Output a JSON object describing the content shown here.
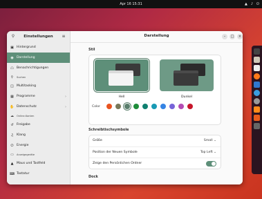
{
  "topbar": {
    "clock": "Apr 16 15:31",
    "status_icons": [
      "network-icon",
      "speaker-icon",
      "power-icon"
    ]
  },
  "sidebar": {
    "title": "Einstellungen",
    "search_icon": "search-icon",
    "menu_icon": "menu-icon",
    "items": [
      {
        "label": "Hintergrund",
        "icon": "image-icon",
        "size": "normal"
      },
      {
        "label": "Darstellung",
        "icon": "palette-icon",
        "size": "normal",
        "active": true
      },
      {
        "label": "Benachrichtigungen",
        "icon": "bell-icon",
        "size": "normal"
      },
      {
        "label": "Suchen",
        "icon": "search-icon",
        "size": "small"
      },
      {
        "label": "Multitasking",
        "icon": "multitasking-icon",
        "size": "normal"
      },
      {
        "label": "Programme",
        "icon": "apps-icon",
        "size": "normal",
        "chevron": true
      },
      {
        "label": "Datenschutz",
        "icon": "hand-icon",
        "size": "normal",
        "chevron": true
      },
      {
        "label": "Online-Konten",
        "icon": "cloud-icon",
        "size": "small"
      },
      {
        "label": "Freigabe",
        "icon": "share-icon",
        "size": "normal"
      },
      {
        "label": "Klang",
        "icon": "music-icon",
        "size": "normal"
      },
      {
        "label": "Energie",
        "icon": "power-icon",
        "size": "normal"
      },
      {
        "label": "Anzeigegeräte",
        "icon": "display-icon",
        "size": "small"
      },
      {
        "label": "Maus und Tastfeld",
        "icon": "mouse-icon",
        "size": "normal"
      },
      {
        "label": "Tastatur",
        "icon": "keyboard-icon",
        "size": "normal"
      }
    ]
  },
  "main": {
    "title": "Darstellung",
    "style": {
      "section": "Stil",
      "options": [
        {
          "label": "Hell",
          "selected": true
        },
        {
          "label": "Dunkel",
          "selected": false
        }
      ],
      "color_label": "Color",
      "colors": [
        "#e95420",
        "#787859",
        "#5b7f6d",
        "#1f8d3a",
        "#0f8070",
        "#199ab4",
        "#3584e4",
        "#7764d8",
        "#b34cb3",
        "#c7162b"
      ],
      "selected_color_index": 2
    },
    "dock": {
      "section": "Schreibtischsymbole",
      "rows": [
        {
          "label": "Größe",
          "value": "Small"
        },
        {
          "label": "Position der Neuen Symbole",
          "value": "Top Left"
        },
        {
          "label": "Zeige den Persönlichen Ordner",
          "toggle": true
        }
      ]
    },
    "dock_section": "Dock"
  },
  "dock_apps": [
    "terminal-icon",
    "files-icon",
    "text-editor-icon",
    "firefox-icon",
    "software-icon",
    "help-icon",
    "settings-icon",
    "disk-icon",
    "trash-icon",
    "ubuntu-installer-icon"
  ]
}
